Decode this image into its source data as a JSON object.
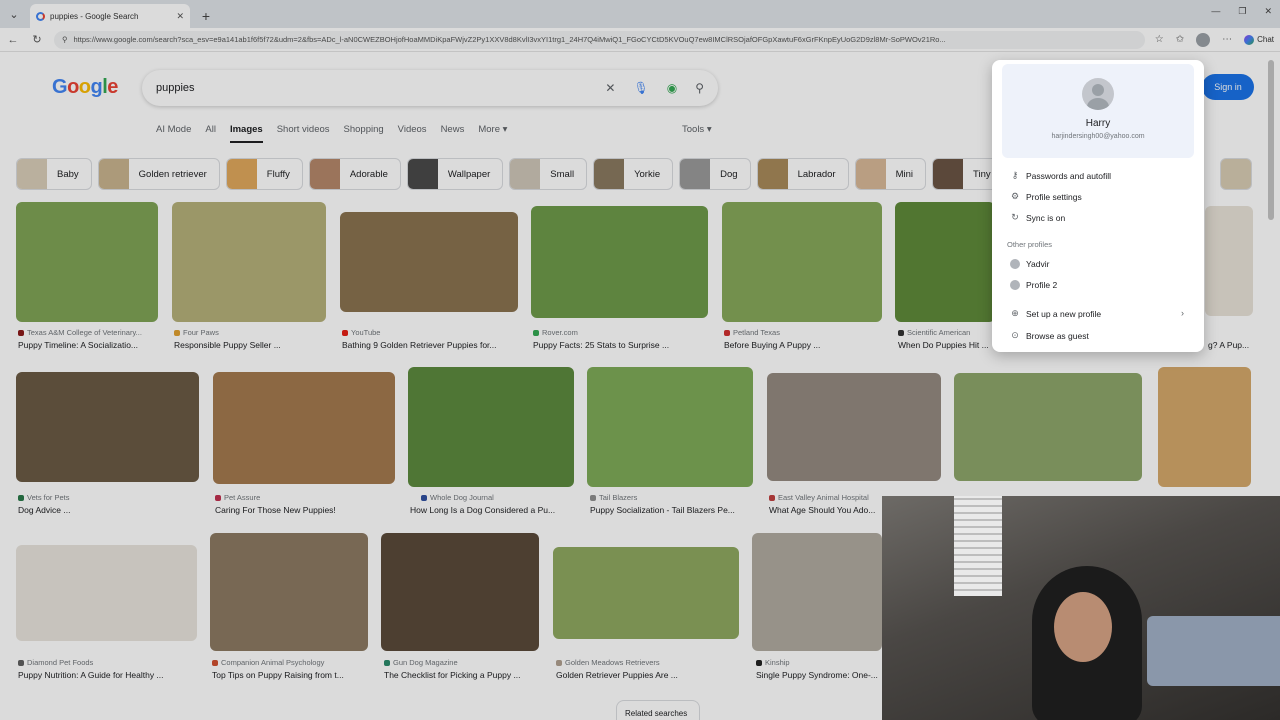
{
  "browser": {
    "tab_title": "puppies - Google Search",
    "url": "https://www.google.com/search?sca_esv=e9a141ab1f6f5f72&udm=2&fbs=ADc_l-aN0CWEZBOHjofHoaMMDiKpaFWjvZ2Py1XXV8d8KvlI3vxYI1trg1_24H7Q4iMwiQ1_FGoCYCtD5KVOuQ7ew8IMClRSOjafOFGpXawtuF6xGrFKnpEyUoG2D9zl8Mr-SoPWOv21Ro...",
    "chat_label": "Chat"
  },
  "google": {
    "logo_letters": [
      "G",
      "o",
      "o",
      "g",
      "l",
      "e"
    ],
    "query": "puppies",
    "signin_label": "Sign in",
    "tabs": [
      "AI Mode",
      "All",
      "Images",
      "Short videos",
      "Shopping",
      "Videos",
      "News",
      "More"
    ],
    "active_tab": "Images",
    "tools_label": "Tools"
  },
  "chips": [
    {
      "label": "Baby",
      "color": "#d9cdb8"
    },
    {
      "label": "Golden retriever",
      "color": "#c9b48e"
    },
    {
      "label": "Fluffy",
      "color": "#e0a85c"
    },
    {
      "label": "Adorable",
      "color": "#b5876a"
    },
    {
      "label": "Wallpaper",
      "color": "#4a4a4a"
    },
    {
      "label": "Small",
      "color": "#cfc6b8"
    },
    {
      "label": "Yorkie",
      "color": "#8a7a60"
    },
    {
      "label": "Dog",
      "color": "#9a9a9a"
    },
    {
      "label": "Labrador",
      "color": "#a88a5a"
    },
    {
      "label": "Mini",
      "color": "#d8b898"
    },
    {
      "label": "Tiny",
      "color": "#6a5444"
    }
  ],
  "results": [
    {
      "source": "Texas A&M College of Veterinary...",
      "title": "Puppy Timeline: A Socializatio...",
      "color": "#7fa356",
      "src_color": "#8b1a1a"
    },
    {
      "source": "Four Paws",
      "title": "Responsible Puppy Seller ...",
      "color": "#b5b07a",
      "src_color": "#e0a030"
    },
    {
      "source": "YouTube",
      "title": "Bathing 9 Golden Retriever Puppies for...",
      "color": "#8a7350",
      "src_color": "#e62117"
    },
    {
      "source": "Rover.com",
      "title": "Puppy Facts: 25 Stats to Surprise ...",
      "color": "#6e9a4a",
      "src_color": "#34a853"
    },
    {
      "source": "Petland Texas",
      "title": "Before Buying A Puppy ...",
      "color": "#86a85a",
      "src_color": "#d03030"
    },
    {
      "source": "Scientific American",
      "title": "When Do Puppies Hit ...",
      "color": "#5f8a3a",
      "src_color": "#333333"
    },
    {
      "source": "Vets for Pets",
      "title": "Dog Advice ...",
      "color": "#6b5a44",
      "src_color": "#2a7a4a"
    },
    {
      "source": "Pet Assure",
      "title": "Caring For Those New Puppies!",
      "color": "#a47a4e",
      "src_color": "#c03050"
    },
    {
      "source": "Whole Dog Journal",
      "title": "How Long Is a Dog Considered a Pu...",
      "color": "#5c8a3e",
      "src_color": "#3050a0"
    },
    {
      "source": "Tail Blazers",
      "title": "Puppy Socialization - Tail Blazers Pe...",
      "color": "#7eaa58",
      "src_color": "#909090"
    },
    {
      "source": "East Valley Animal Hospital",
      "title": "What Age Should You Ado...",
      "color": "#948a80",
      "src_color": "#c04040"
    },
    {
      "source": "Diamond Pet Foods",
      "title": "Puppy Nutrition: A Guide for Healthy ...",
      "color": "#e8e4dc",
      "src_color": "#606060"
    },
    {
      "source": "Companion Animal Psychology",
      "title": "Top Tips on Puppy Raising from t...",
      "color": "#8c7a62",
      "src_color": "#d05030"
    },
    {
      "source": "Gun Dog Magazine",
      "title": "The Checklist for Picking a Puppy ...",
      "color": "#5a4a3a",
      "src_color": "#2a8a6a"
    },
    {
      "source": "Golden Meadows Retrievers",
      "title": "Golden Retriever Puppies Are ...",
      "color": "#8fa860",
      "src_color": "#b0a090"
    },
    {
      "source": "Kinship",
      "title": "Single Puppy Syndrome: One-...",
      "color": "#b0aaa0",
      "src_color": "#222222"
    }
  ],
  "partial_right": {
    "title": "g? A Pup..."
  },
  "row2_extra": [
    "#8da66a",
    "#d4a86a"
  ],
  "related_label": "Related searches",
  "profile": {
    "name": "Harry",
    "email": "harjindersingh00@yahoo.com",
    "items": [
      "Passwords and autofill",
      "Profile settings",
      "Sync is on"
    ],
    "other_profiles_label": "Other profiles",
    "other_profiles": [
      "Yadvir",
      "Profile 2"
    ],
    "setup_label": "Set up a new profile",
    "guest_label": "Browse as guest"
  }
}
